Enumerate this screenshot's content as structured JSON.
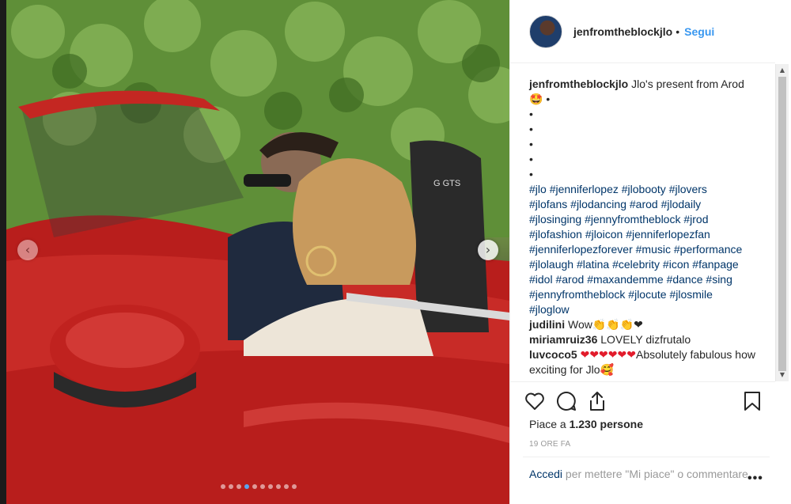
{
  "post": {
    "username": "jenfromtheblockjlo",
    "follow_label": "Segui",
    "separator": "•",
    "caption_text": " Jlo's present from Arod",
    "caption_emoji": "🤩",
    "caption_bullets": [
      "•",
      "•",
      "•",
      "•",
      "•",
      "•"
    ],
    "hashtag_lines": [
      [
        "#jlo",
        "#jenniferlopez",
        "#jlobooty",
        "#jlovers"
      ],
      [
        "#jlofans",
        "#jlodancing",
        "#arod",
        "#jlodaily"
      ],
      [
        "#jlosinging",
        "#jennyfromtheblock",
        "#jrod"
      ],
      [
        "#jlofashion",
        "#jloicon",
        "#jenniferlopezfan"
      ],
      [
        "#jenniferlopezforever",
        "#music",
        "#performance"
      ],
      [
        "#jlolaugh",
        "#latina",
        "#celebrity",
        "#icon",
        "#fanpage"
      ],
      [
        "#idol",
        "#arod",
        "#maxandemme",
        "#dance",
        "#sing"
      ],
      [
        "#jennyfromtheblock",
        "#jlocute",
        "#jlosmile"
      ],
      [
        "#jloglow"
      ]
    ],
    "comments": [
      {
        "user": "judilini",
        "text": " Wow",
        "emoji": "👏👏👏❤"
      },
      {
        "user": "miriamruiz36",
        "text": " LOVELY dizfrutalo",
        "emoji": ""
      },
      {
        "user": "luvcoco5",
        "text": " ",
        "emoji": "❤❤❤❤❤❤",
        "text_after": "Absolutely fabulous how exciting for Jlo",
        "emoji_after": "🥰"
      }
    ],
    "likes_prefix": "Piace a ",
    "likes_count": "1.230 persone",
    "timestamp": "19 ORE FA",
    "login_link": "Accedi",
    "login_rest": " per mettere \"Mi piace\" o commentare.",
    "more_options": "•••"
  },
  "icons": {
    "like": "heart-outline-icon",
    "comment": "speech-bubble-icon",
    "share": "share-upload-icon",
    "save": "bookmark-icon",
    "prev": "chevron-left-icon",
    "next": "chevron-right-icon"
  },
  "nav": {
    "prev_glyph": "‹",
    "next_glyph": "›"
  },
  "carousel": {
    "total": 10,
    "active_index": 3
  },
  "scrollbar": {
    "up": "▲",
    "down": "▼"
  },
  "colors": {
    "link": "#003569",
    "follow": "#3897f0",
    "car_red": "#b8201e",
    "active_dot": "#5aa5f0"
  }
}
